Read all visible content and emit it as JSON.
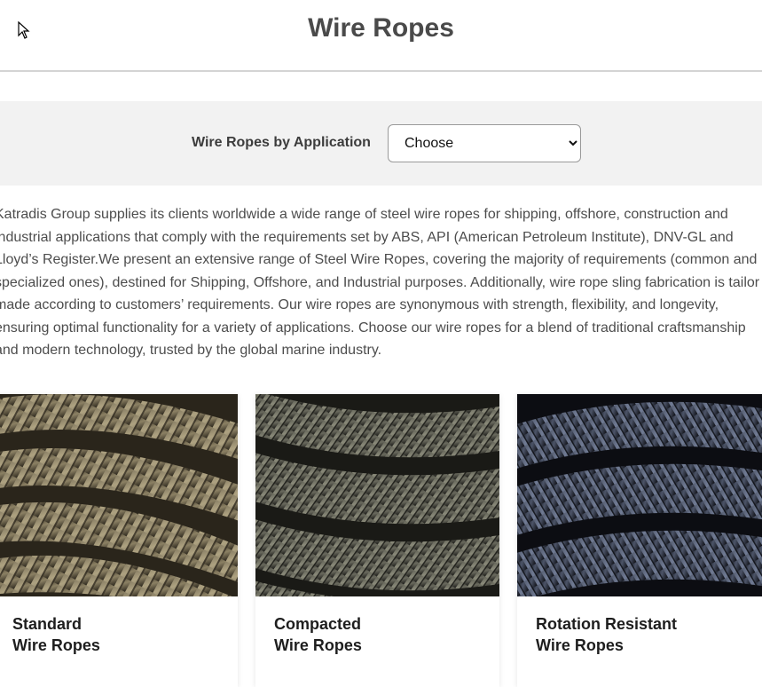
{
  "page": {
    "title": "Wire Ropes"
  },
  "filter": {
    "label": "Wire Ropes by Application",
    "selected": "Choose"
  },
  "intro": {
    "text": "Katradis Group supplies its clients worldwide a wide range of steel wire ropes for shipping, offshore, construction and industrial applications that comply with the requirements set by ABS, API (American Petroleum Institute), DNV-GL and Lloyd’s Register.We present an extensive range of Steel Wire Ropes, covering the majority of requirements (common and specialized ones), destined for Shipping, Offshore,  and Industrial purposes. Additionally, wire rope sling fabrication is tailor made according to customers’ requirements. Our wire ropes are synonymous with strength, flexibility, and longevity, ensuring optimal functionality for a variety of applications. Choose our wire ropes for a blend of traditional craftsmanship and modern technology, trusted by the global marine industry."
  },
  "products": [
    {
      "title_line1": "Standard",
      "title_line2": "Wire Ropes",
      "image": "standard-wire-rope-photo",
      "tone": "#8a7f63"
    },
    {
      "title_line1": "Compacted",
      "title_line2": "Wire Ropes",
      "image": "compacted-wire-rope-photo",
      "tone": "#5f5e57"
    },
    {
      "title_line1": "Rotation Resistant",
      "title_line2": "Wire Ropes",
      "image": "rotation-resistant-wire-rope-photo",
      "tone": "#3c4252"
    }
  ]
}
